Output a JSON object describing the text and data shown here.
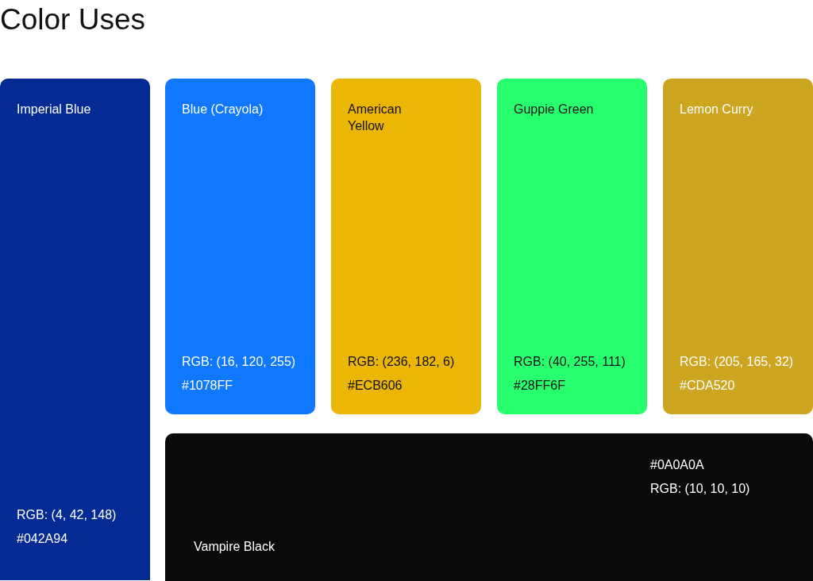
{
  "title": "Color Uses",
  "swatches": [
    {
      "kind": "tall",
      "name": "Imperial Blue",
      "rgb": "RGB: (4, 42, 148)",
      "hex": "#042A94",
      "color": "#042a94",
      "dark_text": false
    },
    {
      "kind": "card",
      "name": "Blue (Crayola)",
      "rgb": "RGB: (16, 120, 255)",
      "hex": "#1078FF",
      "color": "#1078ff",
      "dark_text": false
    },
    {
      "kind": "card",
      "name": "American Yellow",
      "rgb": "RGB: (236, 182, 6)",
      "hex": "#ECB606",
      "color": "#ecb606",
      "dark_text": true
    },
    {
      "kind": "card",
      "name": "Guppie Green",
      "rgb": "RGB: (40, 255, 111)",
      "hex": "#28FF6F",
      "color": "#28ff6f",
      "dark_text": true
    },
    {
      "kind": "card",
      "name": "Lemon Curry",
      "rgb": "RGB: (205, 165, 32)",
      "hex": "#CDA520",
      "color": "#cda520",
      "dark_text": false
    },
    {
      "kind": "wide",
      "name": "Vampire Black",
      "rgb": "RGB: (10, 10, 10)",
      "hex": "#0A0A0A",
      "color": "#0a0a0a",
      "dark_text": false
    }
  ]
}
